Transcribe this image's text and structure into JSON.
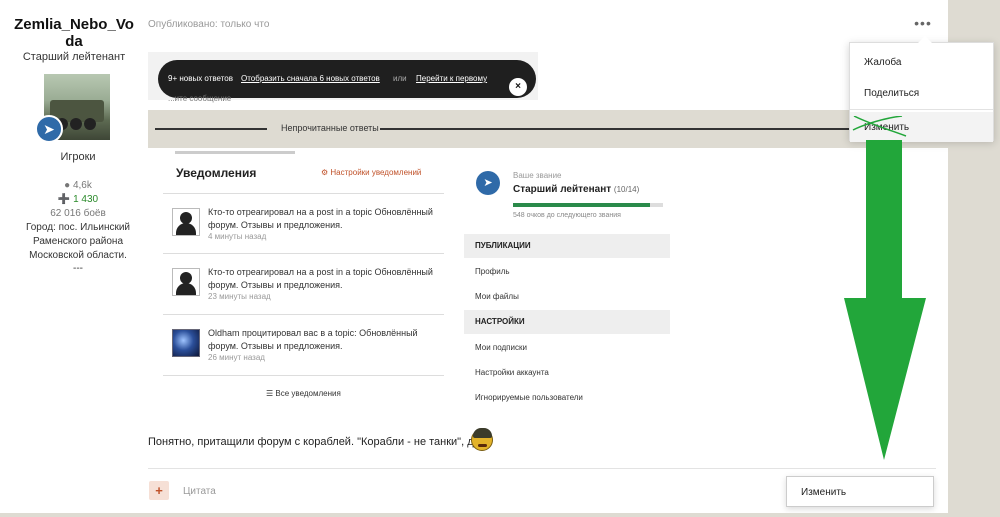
{
  "author": {
    "name": "Zemlia_Nebo_Voda",
    "rank": "Старший лейтенант",
    "group": "Игроки",
    "posts": "4,6k",
    "reputation": "1 430",
    "battles": "62 016 боёв",
    "city": "Город: пос. Ильинский Раменского района Московской области.",
    "separator": "---"
  },
  "post": {
    "published": "Опубликовано: только что",
    "body": "Понятно, притащили форум с кораблей. \"Корабли - не танки\", да?",
    "quote_label": "Цитата",
    "quote_icon": "+",
    "edit_button": "Изменить"
  },
  "dropdown": {
    "items": [
      "Жалоба",
      "Поделиться",
      "Изменить"
    ]
  },
  "embedded": {
    "pill": {
      "count": "9+ новых ответов",
      "show_first": "Отобразить сначала 6 новых ответов",
      "or": "или",
      "go_first": "Перейти к первому",
      "close": "×",
      "ghost": "...ите сообщение"
    },
    "unread_label": "Непрочитанные ответы",
    "notifications": {
      "title": "Уведомления",
      "settings": "Настройки уведомлений",
      "items": [
        {
          "text": "Кто-то отреагировал на a post in a topic Обновлённый форум. Отзывы и предложения.",
          "time": "4 минуты назад",
          "avatar": "person"
        },
        {
          "text": "Кто-то отреагировал на a post in a topic Обновлённый форум. Отзывы и предложения.",
          "time": "23 минуты назад",
          "avatar": "person"
        },
        {
          "text": "Oldham процитировал вас в a topic: Обновлённый форум. Отзывы и предложения.",
          "time": "26 минут назад",
          "avatar": "globe"
        }
      ],
      "all": "Все уведомления"
    },
    "user_menu": {
      "rank_caption": "Ваше звание",
      "rank_name": "Старший лейтенант",
      "rank_progress_text": "(10/14)",
      "rank_progress": 0.91,
      "rank_sub": "548 очков до следующего звания",
      "section_publications": "ПУБЛИКАЦИИ",
      "profile": "Профиль",
      "my_files": "Мои файлы",
      "section_settings": "НАСТРОЙКИ",
      "subscriptions": "Мои подписки",
      "account_settings": "Настройки аккаунта",
      "ignored_users": "Игнорируемые пользователи"
    }
  },
  "colors": {
    "accent": "#c0522a",
    "annotation_arrow": "#22a63a",
    "band": "#dedbd2"
  }
}
